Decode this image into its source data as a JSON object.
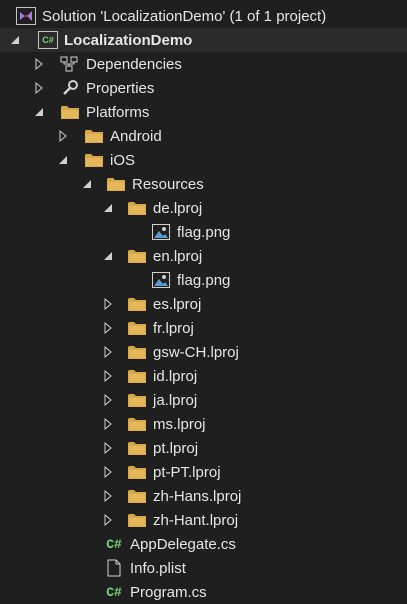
{
  "solution": {
    "title": "Solution 'LocalizationDemo' (1 of 1 project)",
    "icon": "visual-studio-solution-icon"
  },
  "project": {
    "label": "LocalizationDemo",
    "icon": "csharp-project-icon",
    "badge": "C#"
  },
  "nodes": {
    "dependencies": "Dependencies",
    "properties": "Properties",
    "platforms": "Platforms",
    "android": "Android",
    "ios": "iOS",
    "resources": "Resources",
    "de": "de.lproj",
    "de_flag": "flag.png",
    "en": "en.lproj",
    "en_flag": "flag.png",
    "es": "es.lproj",
    "fr": "fr.lproj",
    "gsw": "gsw-CH.lproj",
    "id": "id.lproj",
    "ja": "ja.lproj",
    "ms": "ms.lproj",
    "pt": "pt.lproj",
    "ptpt": "pt-PT.lproj",
    "zhhans": "zh-Hans.lproj",
    "zhhant": "zh-Hant.lproj",
    "appdelegate": "AppDelegate.cs",
    "infoplist": "Info.plist",
    "program": "Program.cs"
  },
  "csharp_badge": "C#",
  "colors": {
    "background": "#1f1f1f",
    "text": "#e6e6e6",
    "folder": "#d8a74a",
    "csharp": "#7bd07b",
    "solution_accent": "#a77bd9"
  }
}
